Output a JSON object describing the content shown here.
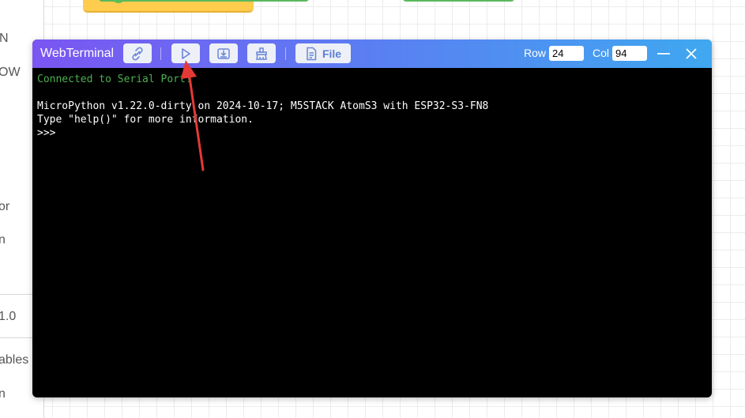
{
  "side_panel": {
    "fragments": [
      "N",
      "OW",
      "or",
      "n",
      "1.0",
      "ables",
      "n"
    ]
  },
  "terminal": {
    "title": "WebTerminal",
    "toolbar": {
      "file_label": "File"
    },
    "row_label": "Row",
    "row_value": "24",
    "col_label": "Col",
    "col_value": "94",
    "lines": [
      "Connected to Serial Port!",
      "",
      "MicroPython v1.22.0-dirty on 2024-10-17; M5STACK AtomS3 with ESP32-S3-FN8",
      "Type \"help()\" for more information.",
      ">>>"
    ]
  },
  "colors": {
    "title_gradient_start": "#7b55f2",
    "title_gradient_end": "#3fa8f0",
    "terminal_bg": "#000000",
    "connected_text": "#4caf50",
    "annotation_arrow": "#e53935"
  },
  "icons": {
    "connect": "link-broken-icon",
    "run": "play-icon",
    "download": "download-to-device-icon",
    "clear": "broom-icon",
    "file": "file-icon",
    "minimize": "minimize-icon",
    "close": "close-icon"
  }
}
